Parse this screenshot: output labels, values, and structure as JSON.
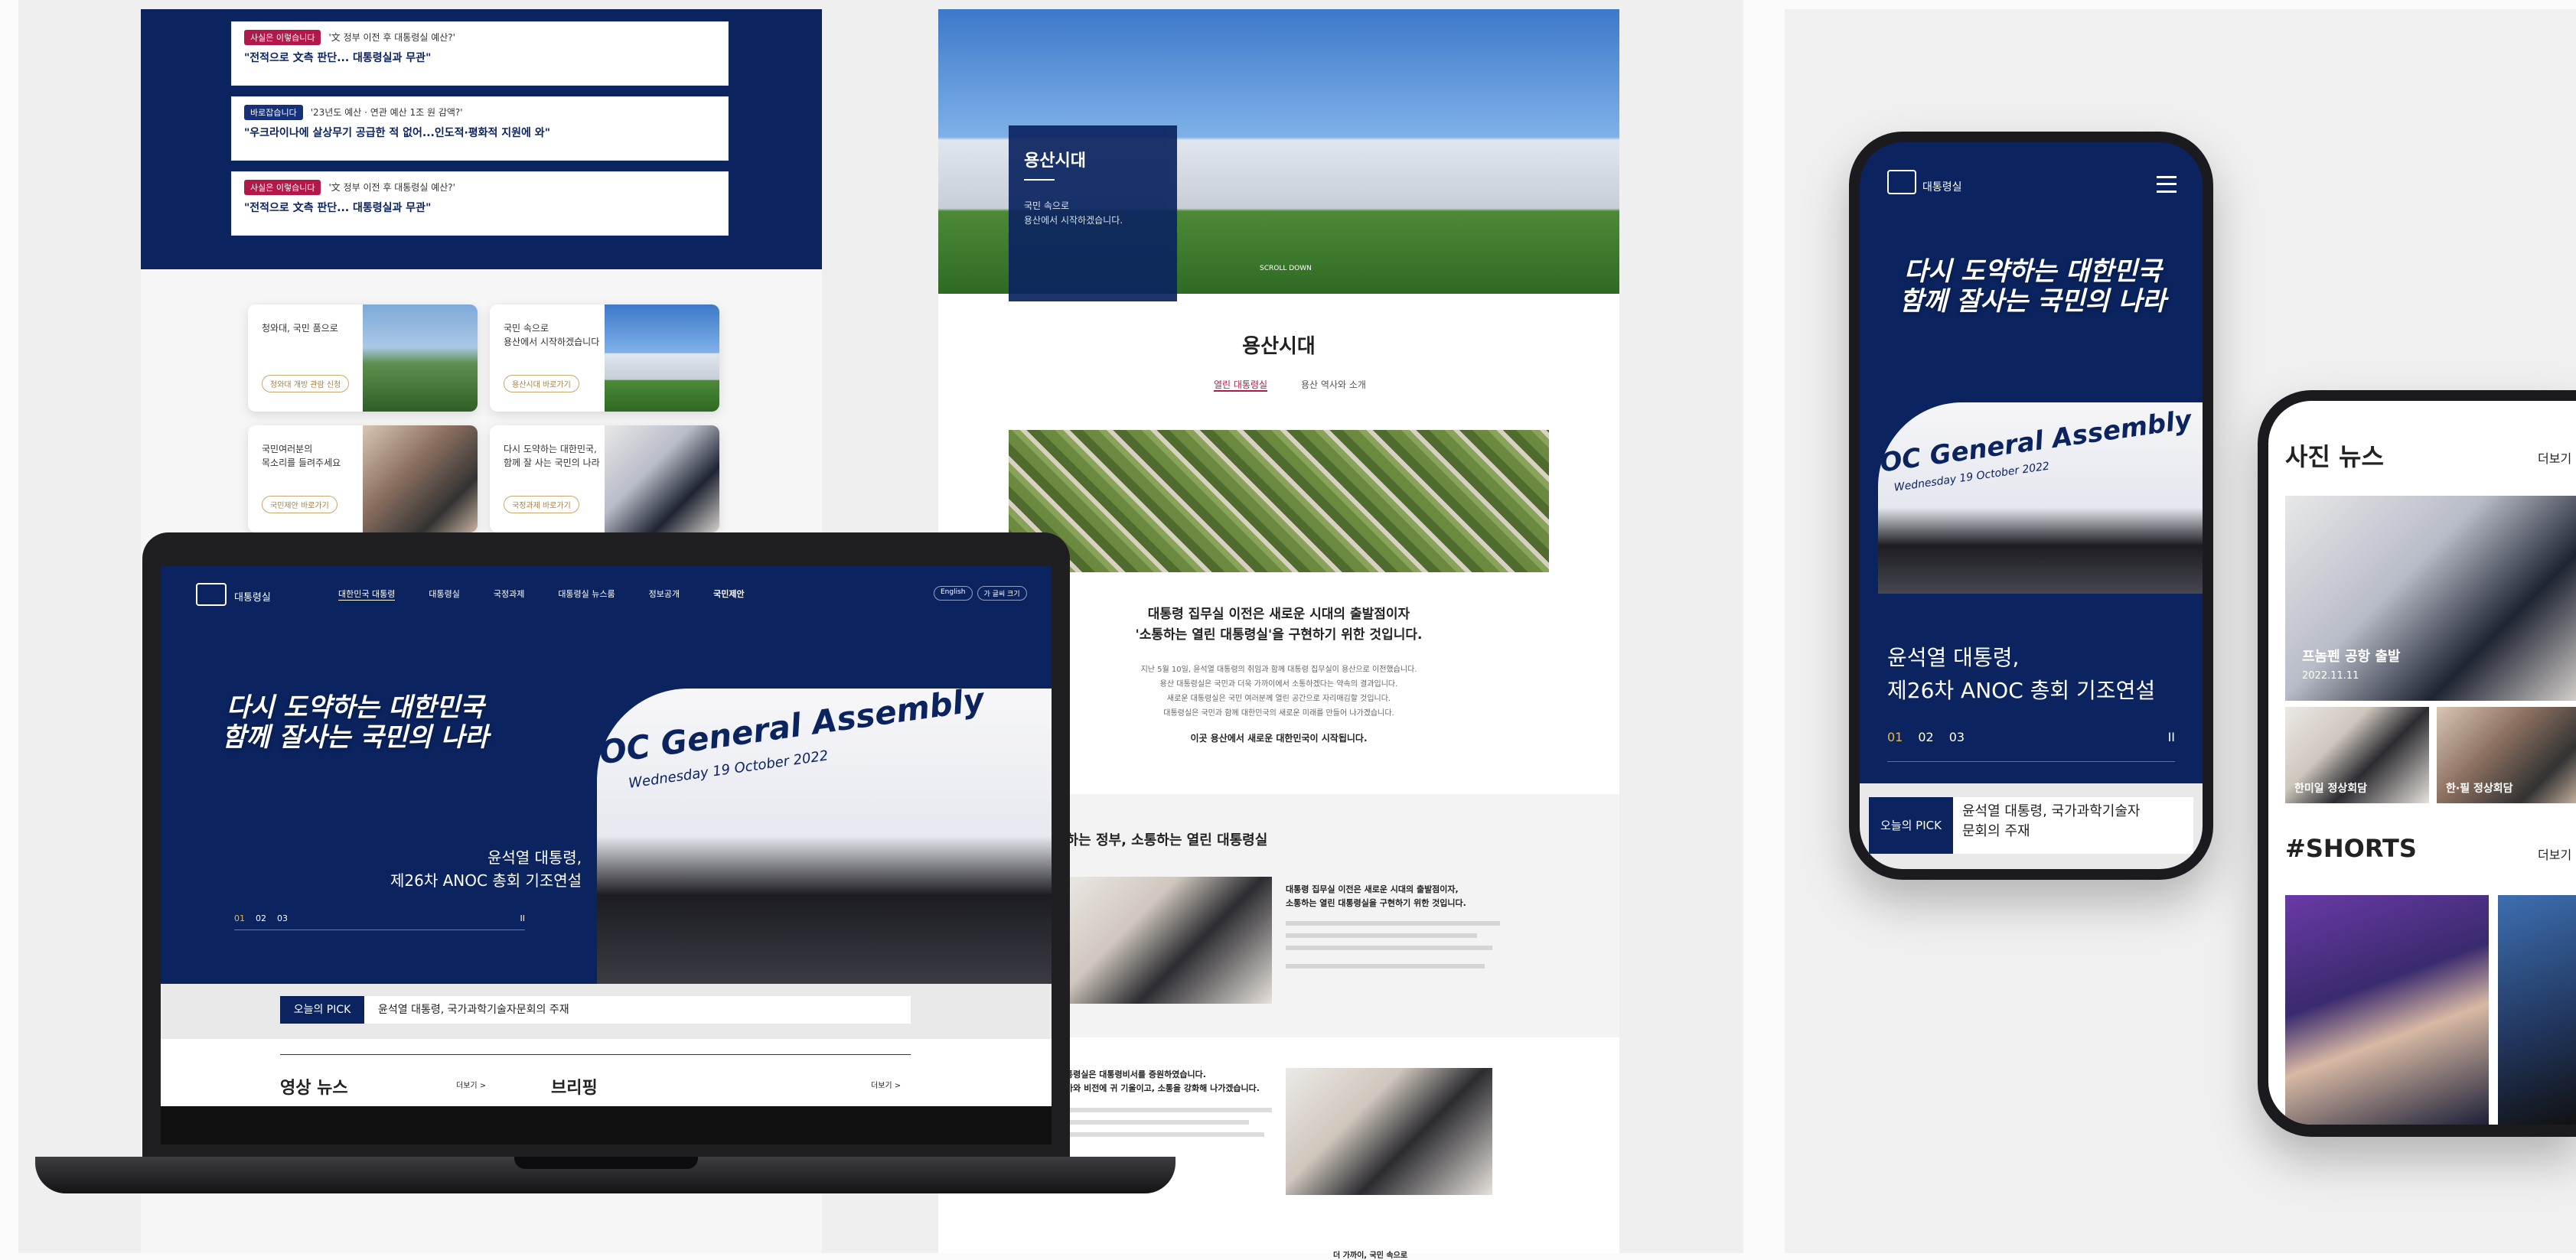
{
  "left_panel": {
    "news_items": [
      {
        "badge": "사실은 이렇습니다",
        "question": "'文 정부 이전 후 대통령실 예산?'",
        "title": "\"전적으로 文측 판단... 대통령실과 무관\""
      },
      {
        "badge": "바로잡습니다",
        "question": "'23년도 예산 · 연관 예산 1조 원 감액?'",
        "title": "\"우크라이나에 살상무기 공급한 적 없어...인도적·평화적 지원에 와\""
      },
      {
        "badge": "사실은 이렇습니다",
        "question": "'文 정부 이전 후 대통령실 예산?'",
        "title": "\"전적으로 文측 판단... 대통령실과 무관\""
      }
    ],
    "cards": [
      {
        "text1": "청와대, 국민 품으로",
        "text2": "",
        "pill": "청와대 개방 관람 신청"
      },
      {
        "text1": "국민 속으로",
        "text2": "용산에서 시작하겠습니다",
        "pill": "용산시대 바로가기"
      },
      {
        "text1": "국민여러분의",
        "text2": "목소리를 들려주세요",
        "pill": "국민제안 바로가기"
      },
      {
        "text1": "다시 도약하는 대한민국,",
        "text2": "함께 잘 사는 국민의 나라",
        "pill": "국정과제 바로가기"
      }
    ]
  },
  "laptop": {
    "logo_text": "대통령실",
    "nav": [
      "대한민국 대통령",
      "대통령실",
      "국정과제",
      "대통령실 뉴스룸",
      "정보공개",
      "국민제안"
    ],
    "lang_buttons": [
      "English",
      "가 글씨 크기"
    ],
    "hero_slogan_1": "다시 도약하는 대한민국",
    "hero_slogan_2": "함께 잘사는 국민의 나라",
    "banner_text": "OC General Assembly",
    "banner_date": "Wednesday 19 October 2022",
    "hero_caption_1": "윤석열 대통령,",
    "hero_caption_2": "제26차 ANOC 총회 기조연설",
    "pager": [
      "01",
      "02",
      "03"
    ],
    "pause": "II",
    "pick_badge": "오늘의 PICK",
    "pick_text": "윤석열 대통령, 국가과학기술자문회의 주재",
    "section_1": "영상 뉴스",
    "section_2": "브리핑",
    "more_1": "더보기 >",
    "more_2": "더보기 >"
  },
  "middle": {
    "hero_title": "용산시대",
    "hero_line1": "국민 속으로",
    "hero_line2": "용산에서 시작하겠습니다.",
    "scroll_label": "SCROLL DOWN",
    "section_title": "용산시대",
    "tabs": [
      "열린 대통령실",
      "용산 역사와 소개"
    ],
    "quote_1": "대통령 집무실 이전은 새로운 시대의 출발점이자",
    "quote_2": "'소통하는 열린 대통령실'을 구현하기 위한 것입니다.",
    "para_lines": [
      "지난 5월 10일, 윤석열 대통령의 취임과 함께 대통령 집무실이 용산으로 이전했습니다.",
      "용산 대통령실은 국민과 더욱 가까이에서 소통하겠다는 약속의 결과입니다.",
      "새로운 대통령실은 국민 여러분께 열린 공간으로 자리매김할 것입니다.",
      "대통령실은 국민과 함께 대한민국의 새로운 미래를 만들어 나가겠습니다."
    ],
    "para_end": "이곳 용산에서 새로운 대한민국이 시작됩니다.",
    "sub_title": "일하는 정부, 소통하는 열린 대통령실",
    "block1_title_1": "대통령 집무실 이전은 새로운 시대의 출발점이자,",
    "block1_title_2": "소통하는 열린 대통령실을 구현하기 위한 것입니다.",
    "block2_title_1": "통령실은 대통령비서를 증원하였습니다.",
    "block2_title_2": "가와 비전에 귀 기울이고, 소통을 강화해 나가겠습니다.",
    "bottom_text": "더 가까이, 국민 속으로"
  },
  "phone1": {
    "logo_text": "대통령실",
    "slogan_1": "다시 도약하는 대한민국",
    "slogan_2": "함께 잘사는 국민의 나라",
    "banner_text": "OC General Assembly",
    "banner_date": "Wednesday 19 October 2022",
    "caption_1": "윤석열 대통령,",
    "caption_2": "제26차 ANOC 총회 기조연설",
    "pager": [
      "01",
      "02",
      "03"
    ],
    "pause": "II",
    "pick_badge": "오늘의 PICK",
    "pick_text_1": "윤석열 대통령, 국가과학기술자",
    "pick_text_2": "문회의 주재"
  },
  "phone2": {
    "section_title": "사진 뉴스",
    "more": "더보기",
    "photo_caption": "프놈펜 공항 출발",
    "photo_date": "2022.11.11",
    "thumb1": "한미일 정상회담",
    "thumb2": "한·필 정상회담",
    "shorts_title": "#SHORTS",
    "shorts_more": "더보기"
  },
  "colors": {
    "navy": "#0b2460",
    "accent_red": "#b3184b",
    "gold": "#c7a86f"
  }
}
